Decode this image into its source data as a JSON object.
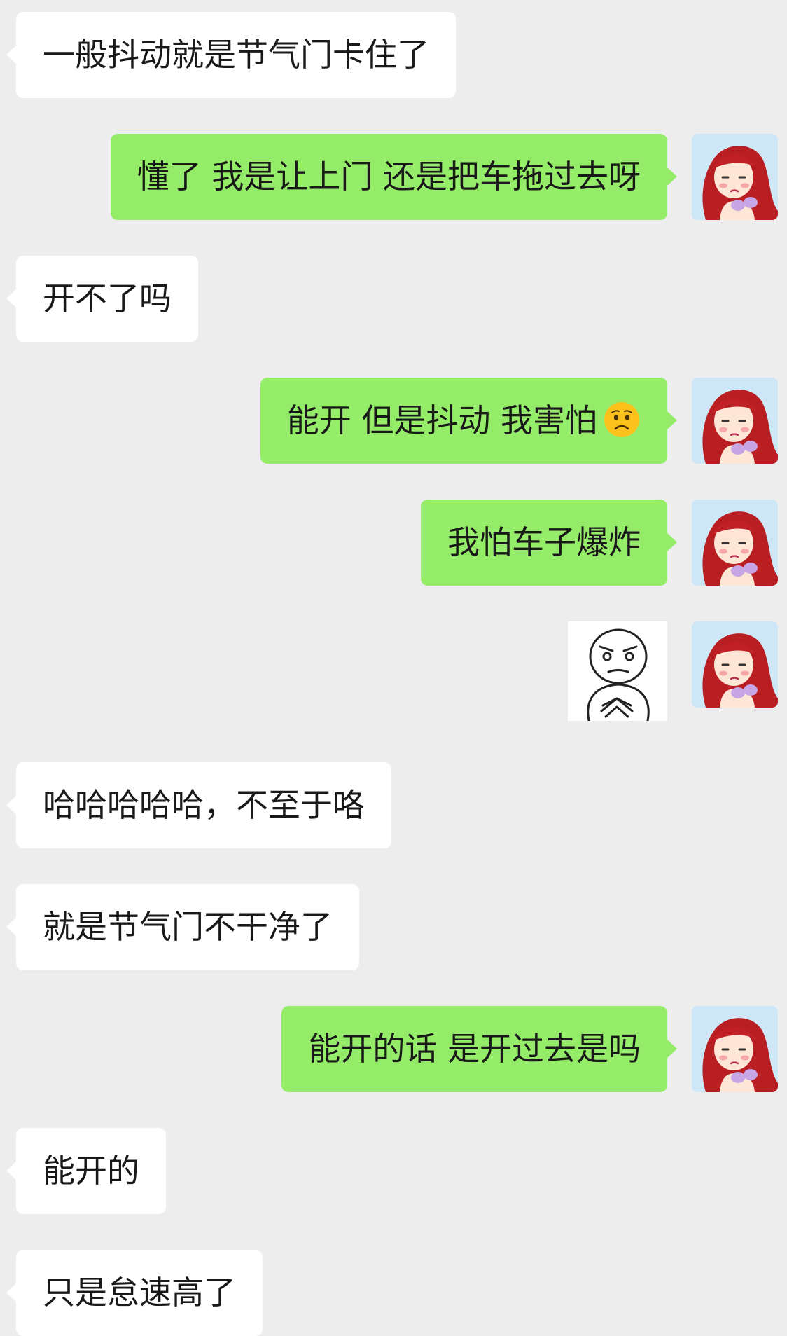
{
  "messages": [
    {
      "side": "in",
      "text": "一般抖动就是节气门卡住了"
    },
    {
      "side": "out",
      "text": "懂了 我是让上门 还是把车拖过去呀"
    },
    {
      "side": "in",
      "text": "开不了吗"
    },
    {
      "side": "out",
      "text": "能开 但是抖动 我害怕",
      "emoji": "worried-face-emoji"
    },
    {
      "side": "out",
      "text": "我怕车子爆炸"
    },
    {
      "side": "out",
      "sticker": "meme-face-fingers-steepled-sticker"
    },
    {
      "side": "in",
      "text": "哈哈哈哈哈，不至于咯"
    },
    {
      "side": "in",
      "text": "就是节气门不干净了"
    },
    {
      "side": "out",
      "text": "能开的话 是开过去是吗"
    },
    {
      "side": "in",
      "text": "能开的"
    },
    {
      "side": "in",
      "text": "只是怠速高了"
    }
  ],
  "colors": {
    "background": "#ededed",
    "incoming_bubble": "#ffffff",
    "outgoing_bubble": "#95ec69",
    "text": "#191919"
  },
  "icons": {
    "avatar": "cartoon-girl-red-hair-avatar"
  }
}
